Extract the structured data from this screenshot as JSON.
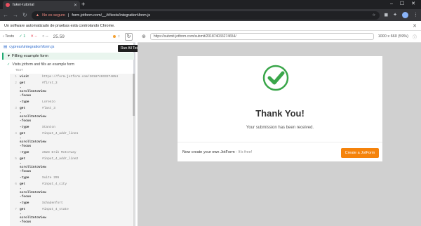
{
  "browser": {
    "tab_title": "faker-tutorial",
    "url_insecure_label": "No es seguro",
    "url": "form.jotform.com/__/#/tests/integration\\form.js",
    "infobar_text": "Un software automatizado de pruebas está controlando Chrome."
  },
  "reporter": {
    "tests_label": "Tests",
    "passed": "1",
    "failed": "--",
    "pending": "--",
    "duration": "25.59",
    "tooltip": "Run All Tests",
    "tooltip_key": "R",
    "spec_file": "cypress\\integration\\form.js",
    "suite_title": "Filling example form",
    "test_title": "Visits jotform and fills an example form",
    "test_label": "TEST",
    "commands": [
      {
        "num": "1",
        "name": "visit",
        "arg": "https://form.jotform.com/201874033274654",
        "child": false
      },
      {
        "num": "2",
        "name": "get",
        "arg": "#first_3",
        "child": false
      },
      {
        "num": "",
        "name": "-scrollIntoView",
        "arg": "",
        "child": true
      },
      {
        "num": "",
        "name": "-focus",
        "arg": "",
        "child": true
      },
      {
        "num": "",
        "name": "-type",
        "arg": "Lorenzo",
        "child": true
      },
      {
        "num": "3",
        "name": "get",
        "arg": "#last_3",
        "child": false
      },
      {
        "num": "",
        "name": "-scrollIntoView",
        "arg": "",
        "child": true
      },
      {
        "num": "",
        "name": "-focus",
        "arg": "",
        "child": true
      },
      {
        "num": "",
        "name": "-type",
        "arg": "Stanton",
        "child": true
      },
      {
        "num": "4",
        "name": "get",
        "arg": "#input_4_addr_line1",
        "child": false
      },
      {
        "num": "",
        "name": "-scrollIntoView",
        "arg": "",
        "child": true
      },
      {
        "num": "",
        "name": "-focus",
        "arg": "",
        "child": true
      },
      {
        "num": "",
        "name": "-type",
        "arg": "2628 Erik Motorway",
        "child": true
      },
      {
        "num": "5",
        "name": "get",
        "arg": "#input_4_addr_line2",
        "child": false
      },
      {
        "num": "",
        "name": "-scrollIntoView",
        "arg": "",
        "child": true
      },
      {
        "num": "",
        "name": "-focus",
        "arg": "",
        "child": true
      },
      {
        "num": "",
        "name": "-type",
        "arg": "Suite 295",
        "child": true
      },
      {
        "num": "6",
        "name": "get",
        "arg": "#input_4_city",
        "child": false
      },
      {
        "num": "",
        "name": "-scrollIntoView",
        "arg": "",
        "child": true
      },
      {
        "num": "",
        "name": "-focus",
        "arg": "",
        "child": true
      },
      {
        "num": "",
        "name": "-type",
        "arg": "Schadenfort",
        "child": true
      },
      {
        "num": "7",
        "name": "get",
        "arg": "#input_4_state",
        "child": false
      },
      {
        "num": "",
        "name": "-scrollIntoView",
        "arg": "",
        "child": true
      },
      {
        "num": "",
        "name": "-focus",
        "arg": "",
        "child": true
      }
    ]
  },
  "aut": {
    "url": "https://submit.jotform.com/submit/201874033274654/",
    "size": "1000 x 660",
    "zoom": "(59%)",
    "thank_you": "Thank You!",
    "received": "Your submission has been received.",
    "create_text": "Now create your own JotForm",
    "create_free": " - It's free!",
    "create_button": "Create a JotForm"
  },
  "colors": {
    "pass": "#1fa971",
    "fail": "#e94f5f",
    "accent_orange": "#f5830b",
    "check_green": "#3aa64a"
  }
}
